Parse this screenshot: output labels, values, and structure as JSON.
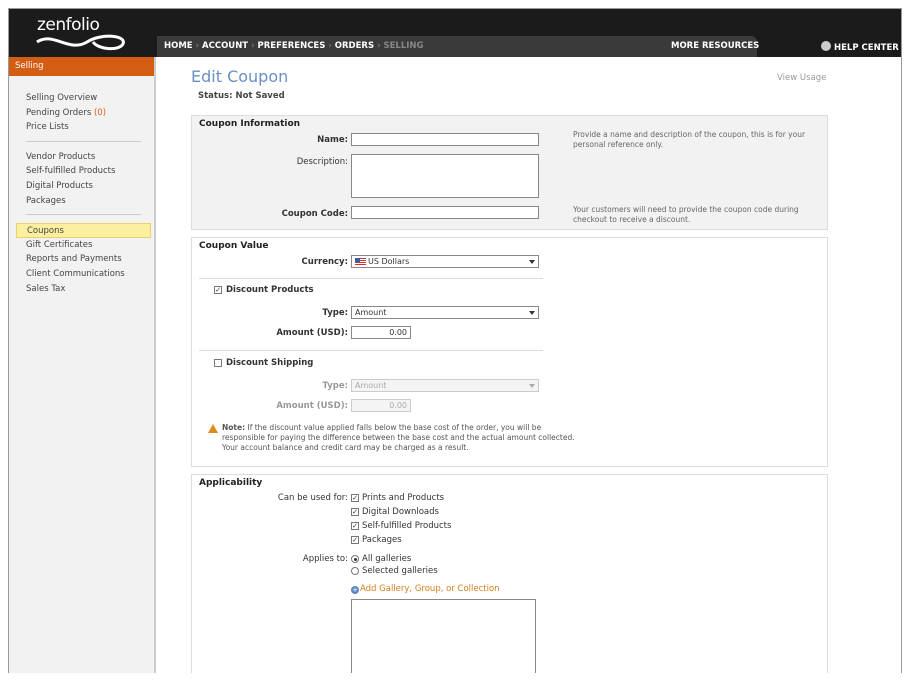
{
  "app": {
    "logo": "zenfolio"
  },
  "nav": {
    "items": [
      "HOME",
      "ACCOUNT",
      "PREFERENCES",
      "ORDERS",
      "SELLING"
    ],
    "more_resources": "MORE RESOURCES",
    "help_center": "HELP CENTER"
  },
  "sidebar": {
    "header": "Selling",
    "group1": [
      {
        "label": "Selling Overview"
      },
      {
        "label": "Pending Orders",
        "count": "(0)"
      },
      {
        "label": "Price Lists"
      }
    ],
    "group2": [
      {
        "label": "Vendor Products"
      },
      {
        "label": "Self-fulfilled Products"
      },
      {
        "label": "Digital Products"
      },
      {
        "label": "Packages"
      }
    ],
    "group3": [
      {
        "label": "Coupons",
        "active": true
      },
      {
        "label": "Gift Certificates"
      },
      {
        "label": "Reports and Payments"
      },
      {
        "label": "Client Communications"
      },
      {
        "label": "Sales Tax"
      }
    ]
  },
  "page": {
    "title": "Edit Coupon",
    "view_usage": "View Usage",
    "status_label": "Status:",
    "status_value": "Not Saved"
  },
  "coupon_info": {
    "title": "Coupon Information",
    "name_label": "Name:",
    "name_value": "",
    "description_label": "Description:",
    "description_value": "",
    "code_label": "Coupon Code:",
    "code_value": "",
    "name_help": "Provide a name and description of the coupon, this is for your personal reference only.",
    "code_help": "Your customers will need to provide the coupon code during checkout to receive a discount."
  },
  "coupon_value": {
    "title": "Coupon Value",
    "currency_label": "Currency:",
    "currency_value": "US Dollars",
    "discount_products_label": "Discount Products",
    "discount_products_checked": true,
    "products_type_label": "Type:",
    "products_type_value": "Amount",
    "products_amount_label": "Amount (USD):",
    "products_amount_value": "0.00",
    "discount_shipping_label": "Discount Shipping",
    "discount_shipping_checked": false,
    "shipping_type_label": "Type:",
    "shipping_type_value": "Amount",
    "shipping_amount_label": "Amount (USD):",
    "shipping_amount_value": "0.00",
    "note_label": "Note:",
    "note_text": "If the discount value applied falls below the base cost of the order, you will be responsible for paying the difference between the base cost and the actual amount collected. Your account balance and credit card may be charged as a result."
  },
  "applicability": {
    "title": "Applicability",
    "used_for_label": "Can be used for:",
    "used_for_options": [
      {
        "label": "Prints and Products",
        "checked": true
      },
      {
        "label": "Digital Downloads",
        "checked": true
      },
      {
        "label": "Self-fulfilled Products",
        "checked": true
      },
      {
        "label": "Packages",
        "checked": true
      }
    ],
    "applies_to_label": "Applies to:",
    "applies_to_options": [
      {
        "label": "All galleries",
        "selected": true
      },
      {
        "label": "Selected galleries",
        "selected": false
      }
    ],
    "add_link": "Add Gallery, Group, or Collection"
  },
  "colors": {
    "accent": "#d45d14",
    "title_blue": "#6a8fc2",
    "link_orange": "#d47d1e"
  }
}
